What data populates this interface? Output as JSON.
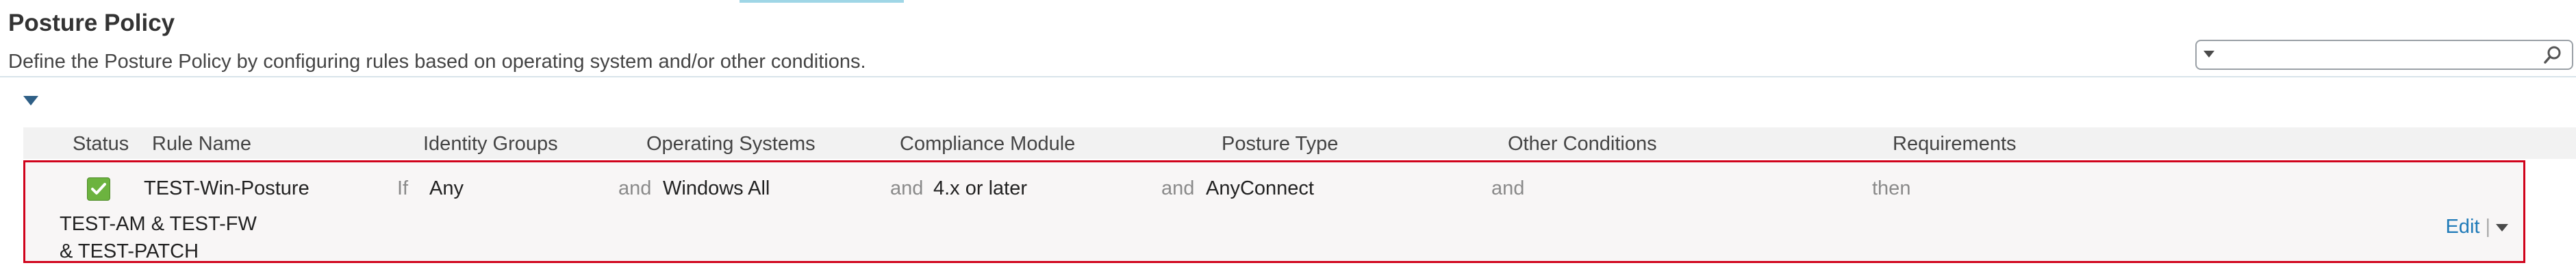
{
  "page": {
    "title": "Posture Policy",
    "description": "Define the Posture Policy by configuring rules based on operating system and/or other conditions."
  },
  "search": {
    "value": "",
    "placeholder": ""
  },
  "table": {
    "columns": [
      "Status",
      "Rule Name",
      "Identity Groups",
      "Operating Systems",
      "Compliance Module",
      "Posture Type",
      "Other Conditions",
      "Requirements"
    ],
    "rows": [
      {
        "status": "enabled",
        "rule_name": "TEST-Win-Posture",
        "if_label": "If",
        "identity_groups": "Any",
        "and_1": "and",
        "operating_systems": "Windows All",
        "and_2": "and",
        "compliance_module": "4.x or later",
        "and_3": "and",
        "posture_type": "AnyConnect",
        "and_4": "and",
        "other_conditions": "",
        "then_label": "then",
        "requirements_line1": "TEST-AM & TEST-FW",
        "requirements_line2": "& TEST-PATCH",
        "edit_label": "Edit",
        "separator": "|"
      }
    ]
  },
  "colors": {
    "accent": "#1f7ab8",
    "highlight_border": "#d0021b",
    "status_green": "#6cb33f"
  },
  "icons": [
    "search-icon",
    "dropdown-icon",
    "collapse-chevron-icon",
    "checkmark-icon",
    "chevron-down-icon"
  ]
}
